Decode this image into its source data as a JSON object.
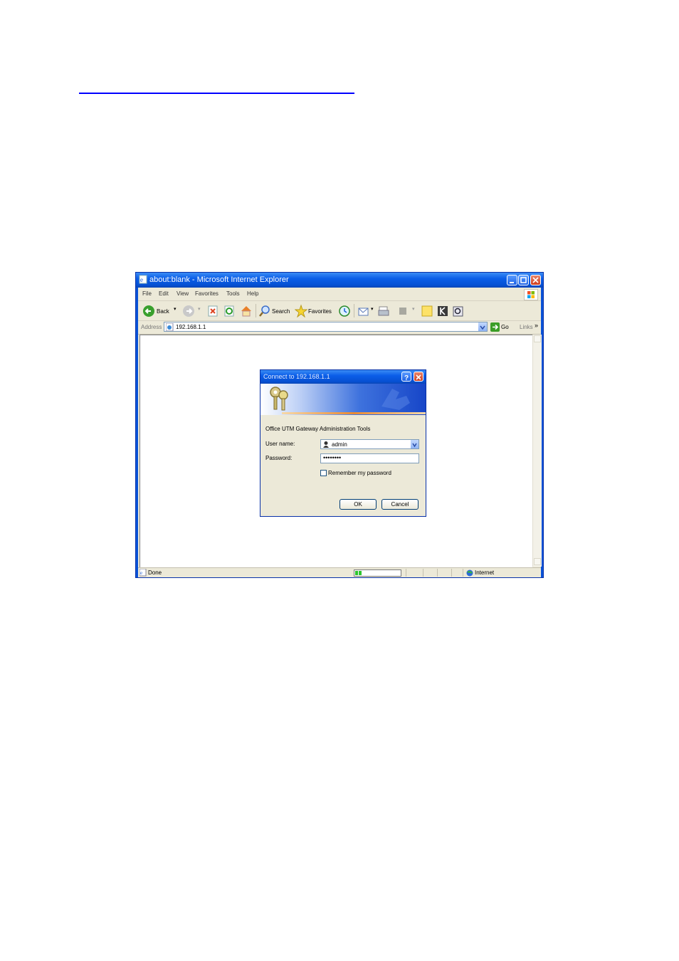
{
  "window": {
    "title": "about:blank - Microsoft Internet Explorer"
  },
  "menu": [
    "File",
    "Edit",
    "View",
    "Favorites",
    "Tools",
    "Help"
  ],
  "toolbar": {
    "back_label": "Back",
    "search_label": "Search",
    "favorites_label": "Favorites"
  },
  "address": {
    "label": "Address",
    "url": "192.168.1.1",
    "go_label": "Go",
    "links_label": "Links",
    "chevron": "»"
  },
  "status": {
    "text": "Done",
    "zone": "Internet",
    "progress": 0.15
  },
  "dialog": {
    "title": "Connect to 192.168.1.1",
    "message": "Office UTM Gateway Administration Tools",
    "username_label": "User name:",
    "username_value": "admin",
    "password_label": "Password:",
    "password_value": "••••••••",
    "remember_label": "Remember my password",
    "remember_checked": false,
    "ok_label": "OK",
    "cancel_label": "Cancel"
  },
  "colors": {
    "titlebar": "#0b5ee8",
    "chrome": "#ece9d8",
    "link": "#0000ff"
  }
}
